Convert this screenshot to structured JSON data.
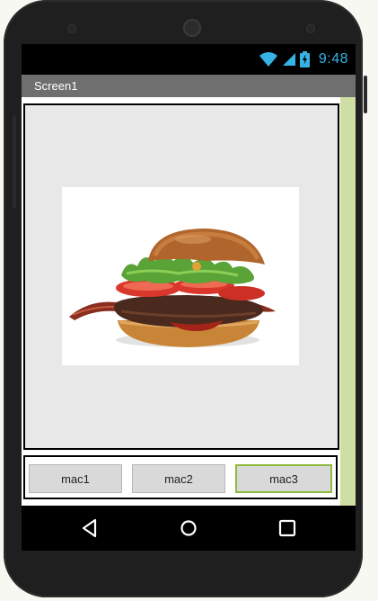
{
  "status_bar": {
    "time": "9:48",
    "accent_color": "#35b3e6",
    "icons": [
      "wifi-icon",
      "signal-icon",
      "battery-icon"
    ]
  },
  "app": {
    "title": "Screen1",
    "title_bar_color": "#6f6f6f",
    "accent_strip_color": "#cfdea5"
  },
  "image": {
    "subject": "hamburger"
  },
  "buttons": [
    {
      "label": "mac1",
      "selected": false
    },
    {
      "label": "mac2",
      "selected": false
    },
    {
      "label": "mac3",
      "selected": true
    }
  ],
  "nav": {
    "icons": [
      "back-icon",
      "home-icon",
      "recents-icon"
    ]
  }
}
